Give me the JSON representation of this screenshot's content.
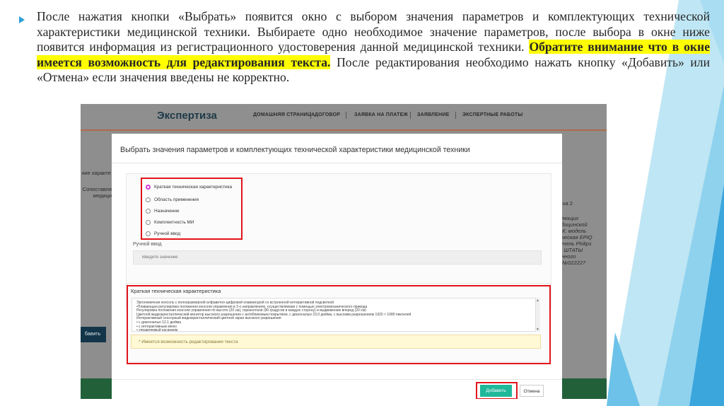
{
  "slide": {
    "text_part1": "После нажатия кнопки «Выбрать» появится окно с выбором значения параметров и комплектующих технической характеристики медицинской техники. Выбираете одно необходимое значение параметров, после выбора в окне ниже появится информация из регистрационного удостоверения данной медицинской техники. ",
    "text_highlight": "Обратите внимание что в окне имеется возможность для редактирования текста.",
    "text_part2": " После редактирования необходимо нажать кнопку «Добавить» или «Отмена» если значения введены не корректно.",
    "accent_color": "#2e9ed6",
    "highlight_color": "#ffff00",
    "annotation_color": "#e0141b"
  },
  "app": {
    "brand": "Экспертиза",
    "nav": [
      "ДОМАШНЯЯ СТРАНИЦА",
      "ДОГОВОР",
      "ЗАЯВКА НА ПЛАТЕЖ",
      "ЗАЯВЛЕНИЕ",
      "ЭКСПЕРТНЫЕ РАБОТЫ"
    ],
    "background": {
      "left_1": "кие характе",
      "left_2": "Сопоставля\nмедици",
      "button": "бавить",
      "right_1": "ка 2",
      "right_2": "алющих\nедицинской\nРК: модель\nическая EPIQ\nнтель Philips\nС ШТАТЫ\nонного\nA№022227"
    }
  },
  "modal": {
    "title": "Выбрать значения параметров и комплектующих технической характеристики медицинской техники",
    "options": [
      "Краткая техническая характеристика",
      "Область применения",
      "Назначение",
      "Комплектность МИ",
      "Ручной ввод"
    ],
    "selected_index": 0,
    "manual_label": "Ручной ввод",
    "manual_placeholder": "Введите значение",
    "char_title": "Краткая техническая характеристика",
    "char_text": "Эргономичная консоль с полноразмерной алфавитно-цифровой клавиатурой со встроенной интерактивной подсветкой\n•Плавающая регулировка положения консоли управления в 3-х направлениях, осуществляемая с помощью электромеханического привода\n Регулировка положения консоли управления по высоте (20 см), горизонтали (90 градусов в каждую сторону) и выдвижению вперед (20 см)\nЦветной жидкокристаллический монитор высокого разрешения с антибликовым покрытием, с диагональю 23,0 дюйма, с высоким разрешением 1920 × 1080 пикселей\nИнтерактивный сенсорный жидкокристаллический цветной экран высокого разрешения\n• с диагональю 12,1 дюйма\n• с интерактивным меню\n• управляемый касанием",
    "note": "* Имеется возможность редактирования текста",
    "add_label": "Добавить",
    "cancel_label": "Отмена"
  }
}
